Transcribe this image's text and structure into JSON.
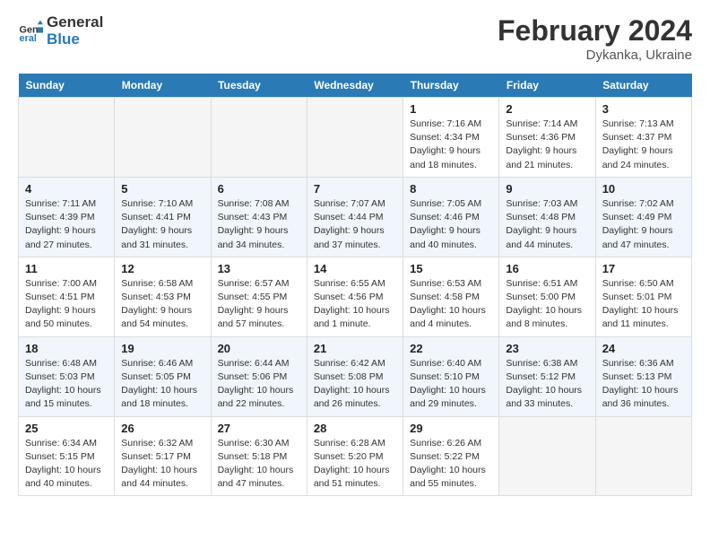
{
  "header": {
    "logo_line1": "General",
    "logo_line2": "Blue",
    "main_title": "February 2024",
    "subtitle": "Dykanka, Ukraine"
  },
  "weekdays": [
    "Sunday",
    "Monday",
    "Tuesday",
    "Wednesday",
    "Thursday",
    "Friday",
    "Saturday"
  ],
  "weeks": [
    [
      {
        "day": "",
        "info": ""
      },
      {
        "day": "",
        "info": ""
      },
      {
        "day": "",
        "info": ""
      },
      {
        "day": "",
        "info": ""
      },
      {
        "day": "1",
        "info": "Sunrise: 7:16 AM\nSunset: 4:34 PM\nDaylight: 9 hours\nand 18 minutes."
      },
      {
        "day": "2",
        "info": "Sunrise: 7:14 AM\nSunset: 4:36 PM\nDaylight: 9 hours\nand 21 minutes."
      },
      {
        "day": "3",
        "info": "Sunrise: 7:13 AM\nSunset: 4:37 PM\nDaylight: 9 hours\nand 24 minutes."
      }
    ],
    [
      {
        "day": "4",
        "info": "Sunrise: 7:11 AM\nSunset: 4:39 PM\nDaylight: 9 hours\nand 27 minutes."
      },
      {
        "day": "5",
        "info": "Sunrise: 7:10 AM\nSunset: 4:41 PM\nDaylight: 9 hours\nand 31 minutes."
      },
      {
        "day": "6",
        "info": "Sunrise: 7:08 AM\nSunset: 4:43 PM\nDaylight: 9 hours\nand 34 minutes."
      },
      {
        "day": "7",
        "info": "Sunrise: 7:07 AM\nSunset: 4:44 PM\nDaylight: 9 hours\nand 37 minutes."
      },
      {
        "day": "8",
        "info": "Sunrise: 7:05 AM\nSunset: 4:46 PM\nDaylight: 9 hours\nand 40 minutes."
      },
      {
        "day": "9",
        "info": "Sunrise: 7:03 AM\nSunset: 4:48 PM\nDaylight: 9 hours\nand 44 minutes."
      },
      {
        "day": "10",
        "info": "Sunrise: 7:02 AM\nSunset: 4:49 PM\nDaylight: 9 hours\nand 47 minutes."
      }
    ],
    [
      {
        "day": "11",
        "info": "Sunrise: 7:00 AM\nSunset: 4:51 PM\nDaylight: 9 hours\nand 50 minutes."
      },
      {
        "day": "12",
        "info": "Sunrise: 6:58 AM\nSunset: 4:53 PM\nDaylight: 9 hours\nand 54 minutes."
      },
      {
        "day": "13",
        "info": "Sunrise: 6:57 AM\nSunset: 4:55 PM\nDaylight: 9 hours\nand 57 minutes."
      },
      {
        "day": "14",
        "info": "Sunrise: 6:55 AM\nSunset: 4:56 PM\nDaylight: 10 hours\nand 1 minute."
      },
      {
        "day": "15",
        "info": "Sunrise: 6:53 AM\nSunset: 4:58 PM\nDaylight: 10 hours\nand 4 minutes."
      },
      {
        "day": "16",
        "info": "Sunrise: 6:51 AM\nSunset: 5:00 PM\nDaylight: 10 hours\nand 8 minutes."
      },
      {
        "day": "17",
        "info": "Sunrise: 6:50 AM\nSunset: 5:01 PM\nDaylight: 10 hours\nand 11 minutes."
      }
    ],
    [
      {
        "day": "18",
        "info": "Sunrise: 6:48 AM\nSunset: 5:03 PM\nDaylight: 10 hours\nand 15 minutes."
      },
      {
        "day": "19",
        "info": "Sunrise: 6:46 AM\nSunset: 5:05 PM\nDaylight: 10 hours\nand 18 minutes."
      },
      {
        "day": "20",
        "info": "Sunrise: 6:44 AM\nSunset: 5:06 PM\nDaylight: 10 hours\nand 22 minutes."
      },
      {
        "day": "21",
        "info": "Sunrise: 6:42 AM\nSunset: 5:08 PM\nDaylight: 10 hours\nand 26 minutes."
      },
      {
        "day": "22",
        "info": "Sunrise: 6:40 AM\nSunset: 5:10 PM\nDaylight: 10 hours\nand 29 minutes."
      },
      {
        "day": "23",
        "info": "Sunrise: 6:38 AM\nSunset: 5:12 PM\nDaylight: 10 hours\nand 33 minutes."
      },
      {
        "day": "24",
        "info": "Sunrise: 6:36 AM\nSunset: 5:13 PM\nDaylight: 10 hours\nand 36 minutes."
      }
    ],
    [
      {
        "day": "25",
        "info": "Sunrise: 6:34 AM\nSunset: 5:15 PM\nDaylight: 10 hours\nand 40 minutes."
      },
      {
        "day": "26",
        "info": "Sunrise: 6:32 AM\nSunset: 5:17 PM\nDaylight: 10 hours\nand 44 minutes."
      },
      {
        "day": "27",
        "info": "Sunrise: 6:30 AM\nSunset: 5:18 PM\nDaylight: 10 hours\nand 47 minutes."
      },
      {
        "day": "28",
        "info": "Sunrise: 6:28 AM\nSunset: 5:20 PM\nDaylight: 10 hours\nand 51 minutes."
      },
      {
        "day": "29",
        "info": "Sunrise: 6:26 AM\nSunset: 5:22 PM\nDaylight: 10 hours\nand 55 minutes."
      },
      {
        "day": "",
        "info": ""
      },
      {
        "day": "",
        "info": ""
      }
    ]
  ]
}
